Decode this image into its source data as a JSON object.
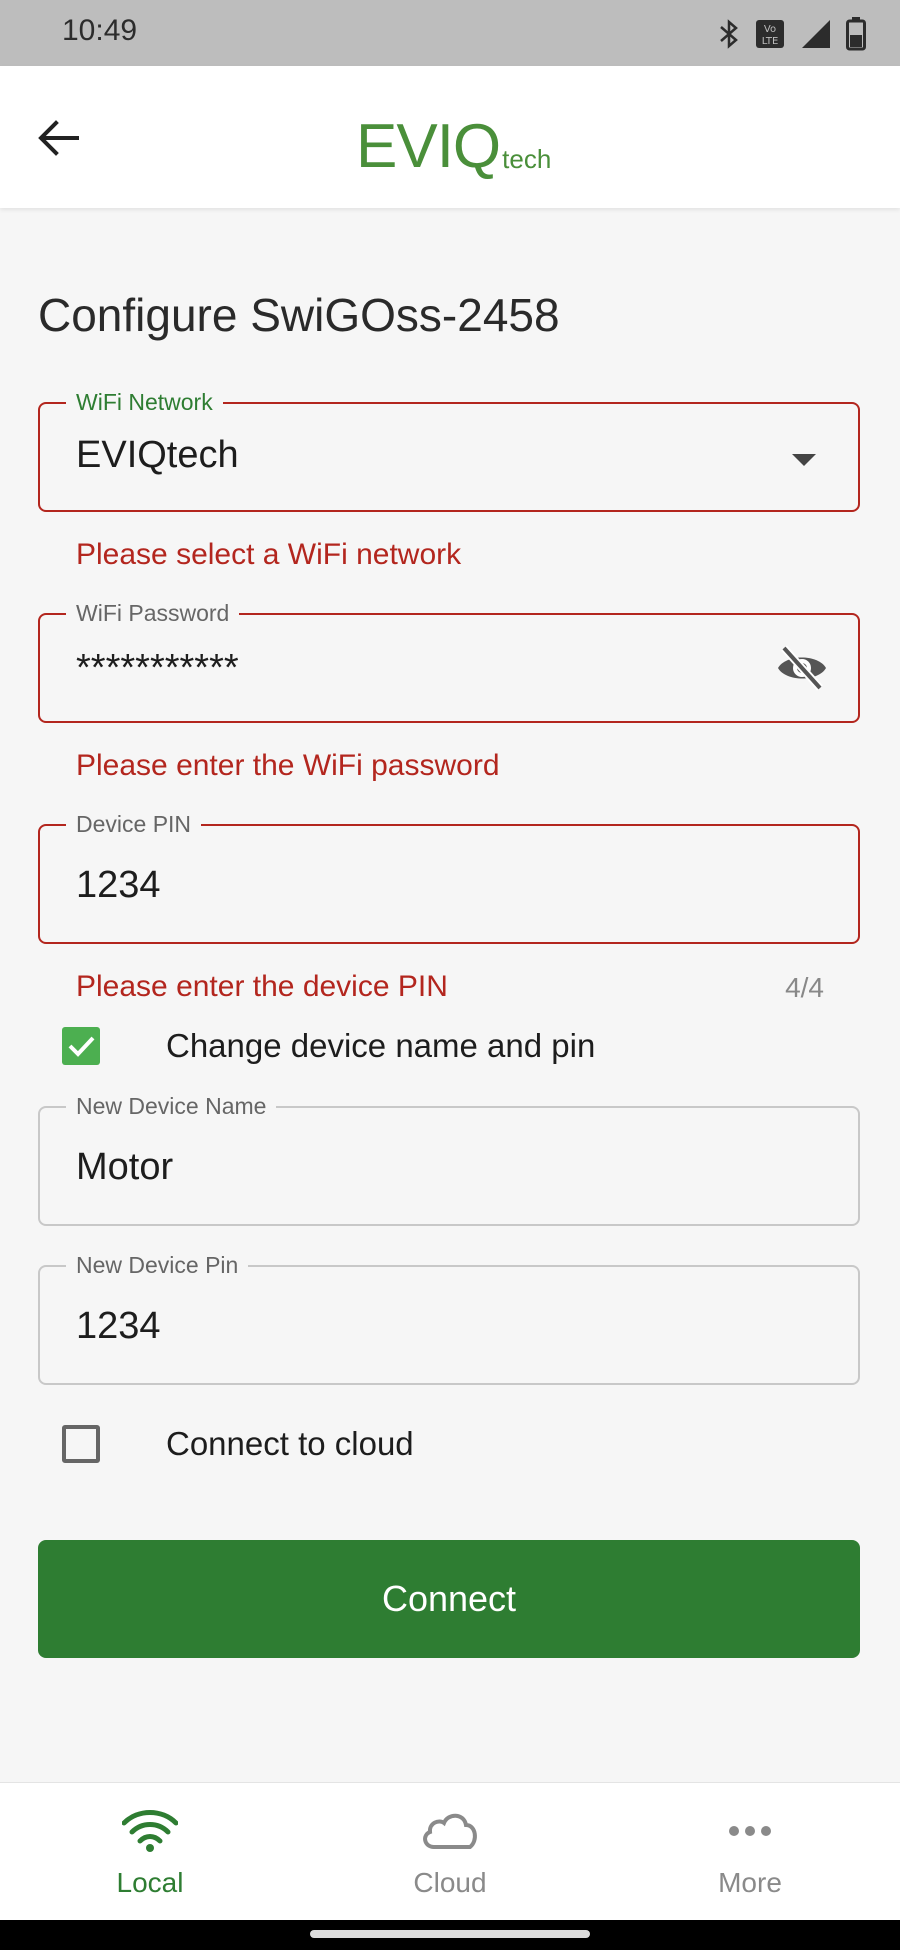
{
  "status_bar": {
    "time": "10:49",
    "lte_badge": "VoLTE"
  },
  "app_bar": {
    "logo_main": "EVIQ",
    "logo_sub": "tech"
  },
  "page": {
    "title": "Configure SwiGOss-2458"
  },
  "wifi_network": {
    "label": "WiFi Network",
    "value": "EVIQtech",
    "error": "Please select a WiFi network"
  },
  "wifi_password": {
    "label": "WiFi Password",
    "value": "***********",
    "error": "Please enter the WiFi password"
  },
  "device_pin": {
    "label": "Device PIN",
    "value": "1234",
    "error": "Please enter the device PIN",
    "counter": "4/4"
  },
  "change_name_pin": {
    "label": "Change device name and pin",
    "checked": true
  },
  "new_device_name": {
    "label": "New Device Name",
    "value": "Motor"
  },
  "new_device_pin": {
    "label": "New Device Pin",
    "value": "1234"
  },
  "connect_cloud": {
    "label": "Connect to cloud",
    "checked": false
  },
  "connect_button": {
    "label": "Connect"
  },
  "bottom_nav": {
    "items": [
      {
        "label": "Local",
        "icon": "wifi-icon",
        "active": true
      },
      {
        "label": "Cloud",
        "icon": "cloud-icon",
        "active": false
      },
      {
        "label": "More",
        "icon": "more-horiz-icon",
        "active": false
      }
    ]
  },
  "colors": {
    "brand_green": "#2e7d32",
    "logo_green": "#4a8f3a",
    "error_red": "#b3261e",
    "checkbox_green": "#4caf50"
  }
}
